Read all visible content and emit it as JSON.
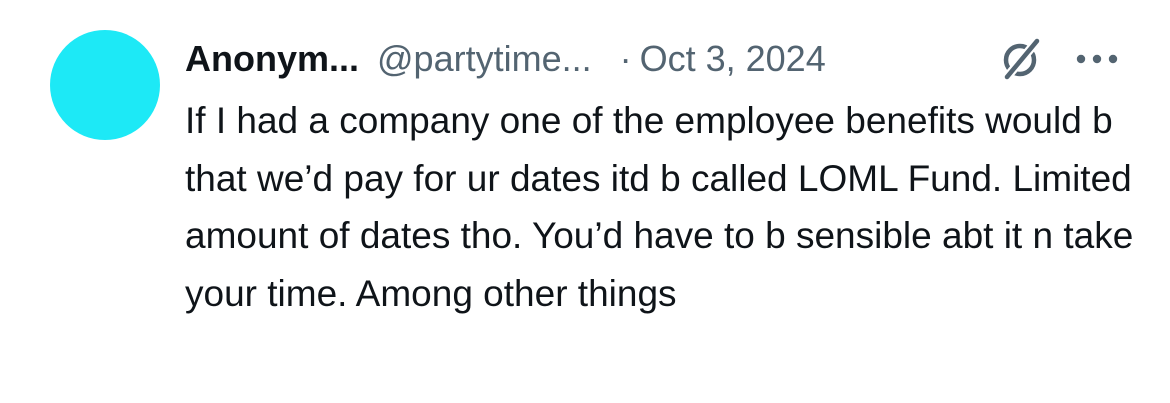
{
  "tweet": {
    "avatar_color": "#1de9f6",
    "display_name": "Anonym...",
    "handle": "@partytime...",
    "separator": "·",
    "date": "Oct 3, 2024",
    "grok_icon": "grok-slash-icon",
    "more_icon": "more-horizontal-icon",
    "text": "If I had a company one of the employee benefits would b that we’d pay for ur dates itd b called LOML Fund. Limited amount of dates tho. You’d have to b sensible abt it n take your time. Among other things",
    "colors": {
      "primary_text": "#0f1419",
      "secondary_text": "#536471"
    }
  }
}
